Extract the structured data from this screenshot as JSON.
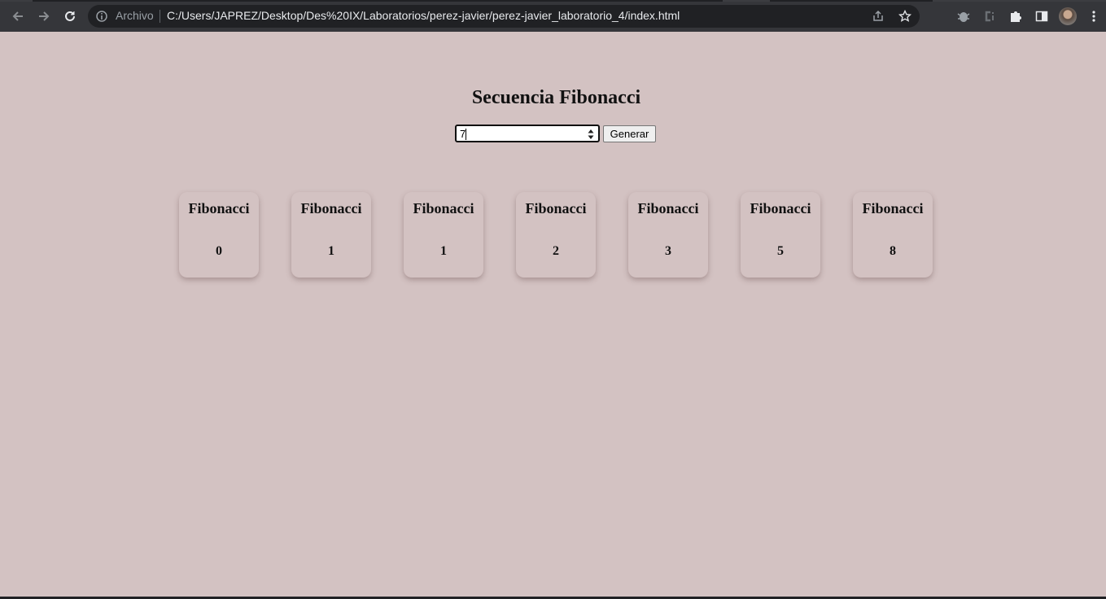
{
  "browser": {
    "security_chip": "Archivo",
    "url": "C:/Users/JAPREZ/Desktop/Des%20IX/Laboratorios/perez-javier/perez-javier_laboratorio_4/index.html"
  },
  "page": {
    "title": "Secuencia Fibonacci",
    "input_value": "7",
    "button_label": "Generar"
  },
  "cards": [
    {
      "title": "Fibonacci",
      "value": "0"
    },
    {
      "title": "Fibonacci",
      "value": "1"
    },
    {
      "title": "Fibonacci",
      "value": "1"
    },
    {
      "title": "Fibonacci",
      "value": "2"
    },
    {
      "title": "Fibonacci",
      "value": "3"
    },
    {
      "title": "Fibonacci",
      "value": "5"
    },
    {
      "title": "Fibonacci",
      "value": "8"
    }
  ],
  "colors": {
    "page_background": "#d3c2c2",
    "toolbar": "#35363a",
    "omnibox": "#202124"
  }
}
